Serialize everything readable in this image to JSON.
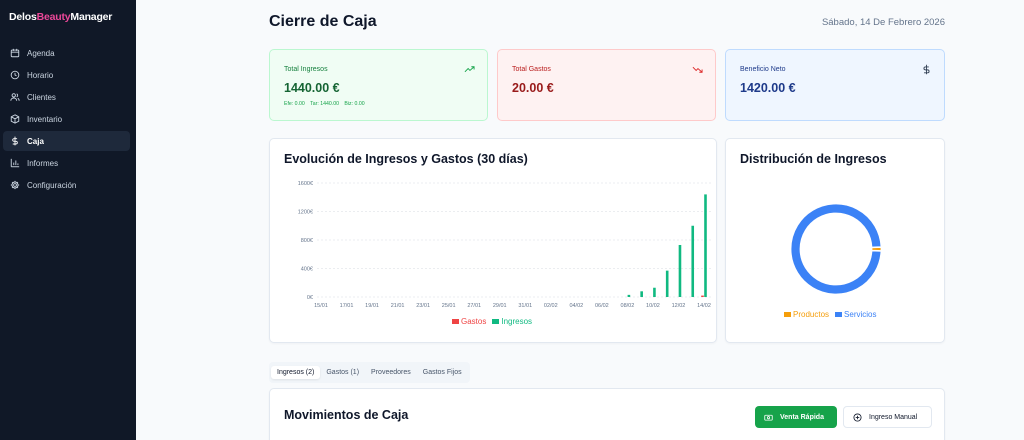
{
  "brand": {
    "part1": "Delos",
    "part2": "Beauty",
    "part3": "Manager"
  },
  "sidebar": {
    "items": [
      {
        "label": "Agenda",
        "icon": "calendar-icon"
      },
      {
        "label": "Horario",
        "icon": "clock-icon"
      },
      {
        "label": "Clientes",
        "icon": "users-icon"
      },
      {
        "label": "Inventario",
        "icon": "box-icon"
      },
      {
        "label": "Caja",
        "icon": "dollar-icon",
        "active": true
      },
      {
        "label": "Informes",
        "icon": "bar-chart-icon"
      },
      {
        "label": "Configuración",
        "icon": "gear-icon"
      }
    ]
  },
  "header": {
    "title": "Cierre de Caja",
    "date": "Sábado, 14 De Febrero 2026"
  },
  "stats": {
    "ingresos": {
      "label": "Total Ingresos",
      "value": "1440.00 €",
      "sub": [
        "Efe: 0.00",
        "Tar: 1440.00",
        "Biz: 0.00"
      ],
      "icon": "trending-up-icon"
    },
    "gastos": {
      "label": "Total Gastos",
      "value": "20.00 €",
      "icon": "trending-down-icon"
    },
    "neto": {
      "label": "Beneficio Neto",
      "value": "1420.00 €",
      "icon": "dollar-icon"
    }
  },
  "evolution": {
    "title": "Evolución de Ingresos y Gastos (30 días)"
  },
  "distribution": {
    "title": "Distribución de Ingresos"
  },
  "chart_data": [
    {
      "type": "bar",
      "title": "Evolución de Ingresos y Gastos (30 días)",
      "x_tick_labels": [
        "15/01",
        "17/01",
        "19/01",
        "21/01",
        "23/01",
        "25/01",
        "27/01",
        "29/01",
        "31/01",
        "02/02",
        "04/02",
        "06/02",
        "08/02",
        "10/02",
        "12/02",
        "14/02"
      ],
      "y_ticks": [
        "0€",
        "400€",
        "800€",
        "1200€",
        "1600€"
      ],
      "ylim": [
        0,
        1600
      ],
      "grid": true,
      "legend": "bottom",
      "categories": [
        "15/01",
        "16/01",
        "17/01",
        "18/01",
        "19/01",
        "20/01",
        "21/01",
        "22/01",
        "23/01",
        "24/01",
        "25/01",
        "26/01",
        "27/01",
        "28/01",
        "29/01",
        "30/01",
        "31/01",
        "01/02",
        "02/02",
        "03/02",
        "04/02",
        "05/02",
        "06/02",
        "07/02",
        "08/02",
        "09/02",
        "10/02",
        "11/02",
        "12/02",
        "13/02",
        "14/02"
      ],
      "series": [
        {
          "name": "Gastos",
          "color": "#ef4444",
          "values": [
            0,
            0,
            0,
            0,
            0,
            0,
            0,
            0,
            0,
            0,
            0,
            0,
            0,
            0,
            0,
            0,
            0,
            0,
            0,
            0,
            0,
            0,
            0,
            0,
            0,
            0,
            0,
            0,
            0,
            0,
            20
          ]
        },
        {
          "name": "Ingresos",
          "color": "#10b981",
          "values": [
            0,
            0,
            0,
            0,
            0,
            0,
            0,
            0,
            0,
            0,
            0,
            0,
            0,
            0,
            0,
            0,
            0,
            0,
            0,
            0,
            0,
            0,
            0,
            0,
            30,
            80,
            130,
            370,
            730,
            1000,
            1440
          ]
        }
      ]
    },
    {
      "type": "pie",
      "title": "Distribución de Ingresos",
      "legend": "bottom",
      "slices": [
        {
          "label": "Productos",
          "value": 20,
          "color": "#f59e0b"
        },
        {
          "label": "Servicios",
          "value": 1420,
          "color": "#3b82f6"
        }
      ]
    }
  ],
  "tabs": [
    {
      "label": "Ingresos (2)",
      "active": true
    },
    {
      "label": "Gastos (1)"
    },
    {
      "label": "Proveedores"
    },
    {
      "label": "Gastos Fijos"
    }
  ],
  "movements": {
    "title": "Movimientos de Caja",
    "quick_sale_label": "Venta Rápida",
    "manual_income_label": "Ingreso Manual",
    "quick_sale_icon": "cash-icon",
    "manual_income_icon": "plus-circle-icon"
  },
  "colors": {
    "sidebar_bg": "#101827",
    "brand_accent": "#ec4899",
    "income": "#10b981",
    "expense": "#ef4444",
    "products": "#f59e0b",
    "services": "#3b82f6"
  }
}
